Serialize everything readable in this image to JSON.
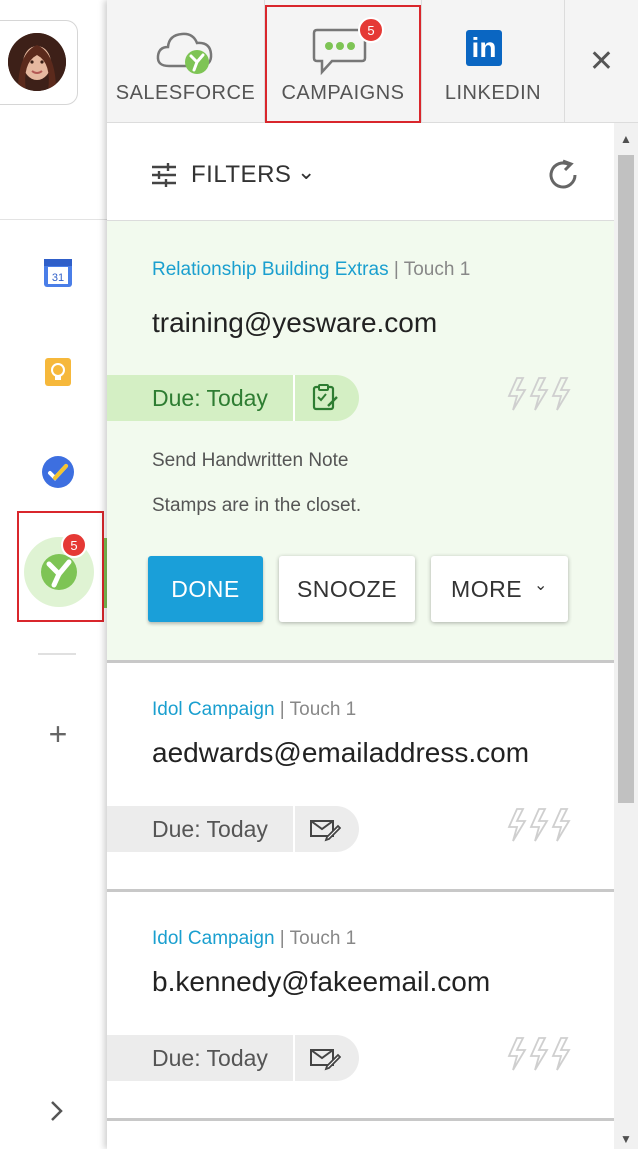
{
  "rail": {
    "calendar_day": "31",
    "yesware_badge": "5",
    "icons": [
      "avatar",
      "google-calendar-icon",
      "keep-icon",
      "tasks-icon",
      "yesware-icon",
      "plus-icon",
      "chevron-right-icon"
    ]
  },
  "tabs": [
    {
      "label": "SALESFORCE",
      "icon": "salesforce-cloud-icon"
    },
    {
      "label": "CAMPAIGNS",
      "icon": "chat-bubble-icon",
      "badge": "5"
    },
    {
      "label": "LINKEDIN",
      "icon": "linkedin-icon",
      "logo_text": "in"
    }
  ],
  "close_glyph": "✕",
  "filters": {
    "label": "FILTERS",
    "chevron": "⌄"
  },
  "touches": [
    {
      "campaign": "Relationship Building Extras",
      "touch": " | Touch 1",
      "email": "training@yesware.com",
      "due": "Due: Today",
      "title": "Send Handwritten Note",
      "note": "Stamps are in the closet.",
      "buttons": {
        "done": "DONE",
        "snooze": "SNOOZE",
        "more": "MORE"
      },
      "more_chevron": "⌄"
    },
    {
      "campaign": "Idol Campaign",
      "touch": " | Touch 1",
      "email": "aedwards@emailaddress.com",
      "due": "Due: Today"
    },
    {
      "campaign": "Idol Campaign",
      "touch": " | Touch 1",
      "email": "b.kennedy@fakeemail.com",
      "due": "Due: Today"
    }
  ],
  "colors": {
    "accent": "#1a9fd9",
    "link": "#1a9fcf",
    "active_bg": "#f2faee",
    "badge": "#e53935",
    "yesware_green": "#7ec455"
  }
}
